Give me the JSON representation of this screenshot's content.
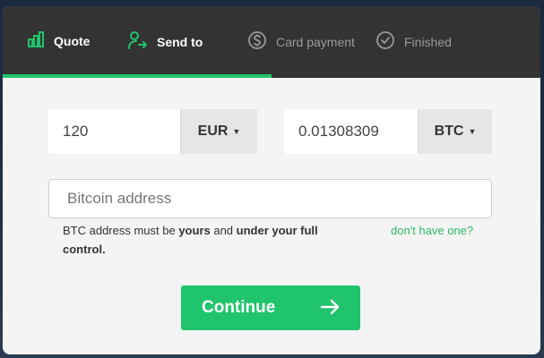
{
  "steps": [
    {
      "label": "Quote",
      "icon": "bar-chart-icon",
      "state": "done"
    },
    {
      "label": "Send to",
      "icon": "user-arrow-icon",
      "state": "done"
    },
    {
      "label": "Card payment",
      "icon": "dollar-circle-icon",
      "state": "todo"
    },
    {
      "label": "Finished",
      "icon": "check-circle-icon",
      "state": "todo"
    }
  ],
  "progress": {
    "completed_steps": 2,
    "total_steps": 4,
    "fraction": 0.5
  },
  "quote": {
    "fiat_amount": "120",
    "fiat_currency": "EUR",
    "crypto_amount": "0.01308309",
    "crypto_currency": "BTC"
  },
  "address": {
    "placeholder": "Bitcoin address",
    "value": ""
  },
  "note": {
    "part1": "BTC address must be ",
    "bold1": "yours",
    "part2": " and ",
    "bold2": "under your full control",
    "part3": "."
  },
  "help_link": "don't have one?",
  "continue_label": "Continue",
  "colors": {
    "accent": "#1fc46d",
    "header_bg": "#333333",
    "card_bg": "#f4f4f4"
  }
}
